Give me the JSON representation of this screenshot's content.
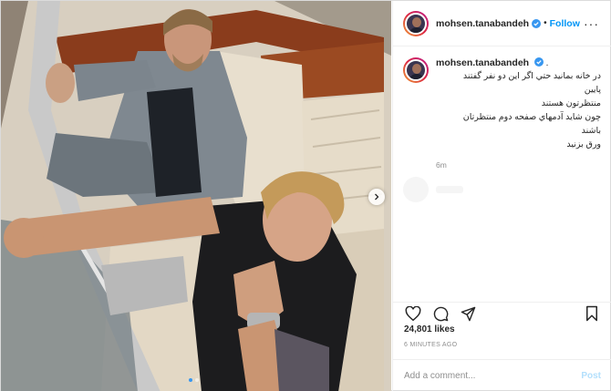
{
  "post": {
    "username": "mohsen.tanabandeh",
    "separator": "•",
    "follow_label": "Follow",
    "more_icon": "more-options-icon",
    "caption": {
      "username": "mohsen.tanabandeh",
      "lines": [
        "در خانه بمانيد حتي اگر اين دو نفر گفتند",
        "پايين",
        "منتظرتون هستند",
        "چون شايد آدمهاي صفحه دوم منتظرتان",
        "باشند",
        "ورق بزنيد"
      ],
      "time": "6m"
    },
    "actions": {
      "like_icon": "heart-icon",
      "comment_icon": "comment-icon",
      "share_icon": "share-icon",
      "save_icon": "bookmark-icon"
    },
    "likes": "24,801 likes",
    "posted_ago": "6 MINUTES AGO",
    "comment": {
      "placeholder": "Add a comment...",
      "value": "",
      "post_label": "Post"
    },
    "carousel": {
      "total": 2,
      "current": 1,
      "next_icon": "chevron-right-icon"
    },
    "colors": {
      "accent": "#0095f6",
      "post_disabled": "#b2dffc",
      "muted": "#8e8e8e",
      "text": "#262626",
      "active_dot": "#3897f0"
    }
  }
}
